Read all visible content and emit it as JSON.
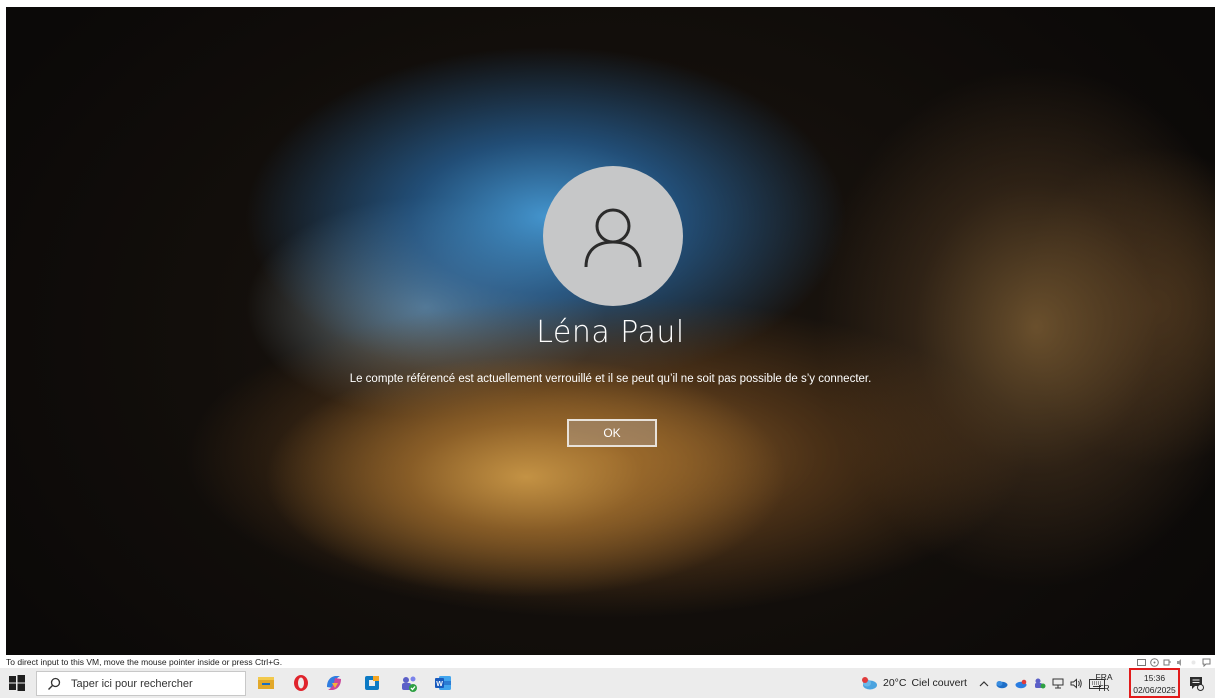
{
  "lock_screen": {
    "user_name": "Léna Paul",
    "message": "Le compte référencé est actuellement verrouillé et il se peut qu’il ne soit pas possible de s’y connecter.",
    "ok_label": "OK",
    "avatar_icon": "user-icon"
  },
  "vm_hint": {
    "text": "To direct input to this VM, move the mouse pointer inside or press Ctrl+G."
  },
  "taskbar": {
    "search_placeholder": "Taper ici pour rechercher",
    "apps": [
      {
        "name": "file-explorer-icon"
      },
      {
        "name": "opera-icon"
      },
      {
        "name": "copilot-icon"
      },
      {
        "name": "office-icon"
      },
      {
        "name": "teams-icon"
      },
      {
        "name": "word-icon"
      }
    ],
    "weather": {
      "temp": "20°C",
      "condition": "Ciel couvert"
    },
    "language": {
      "line1": "FRA",
      "line2": "FR"
    },
    "clock": {
      "time": "15:36",
      "date": "02/06/2025"
    }
  },
  "colors": {
    "taskbar_bg": "#ececec",
    "clock_highlight": "#e21b1b",
    "avatar_bg": "#c6c7c8"
  }
}
